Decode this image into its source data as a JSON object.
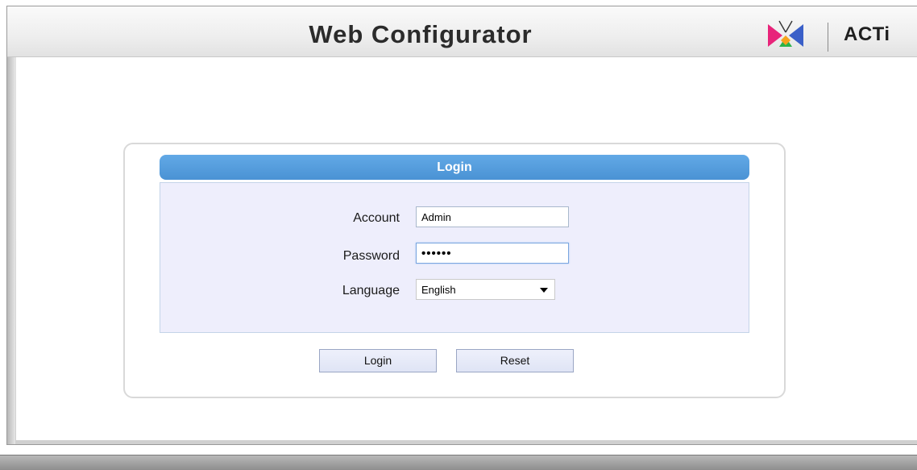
{
  "header": {
    "title": "Web Configurator",
    "brand": "ACTi"
  },
  "login": {
    "panel_title": "Login",
    "account_label": "Account",
    "account_value": "Admin",
    "password_label": "Password",
    "password_value": "••••••",
    "language_label": "Language",
    "language_selected": "English",
    "login_button": "Login",
    "reset_button": "Reset"
  },
  "colors": {
    "titlebar": "#4a92d4",
    "form_background": "#eeeefc"
  },
  "icons": {
    "logo": "acti-logo-icon",
    "dropdown": "chevron-down-icon"
  }
}
